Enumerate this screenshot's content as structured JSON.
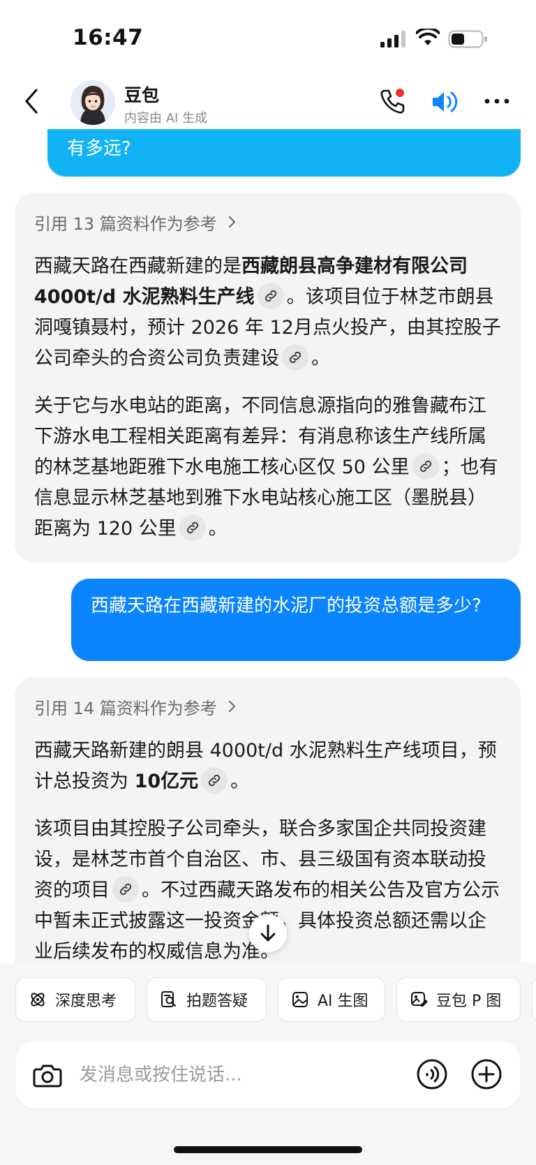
{
  "status": {
    "time": "16:47"
  },
  "header": {
    "bot_name": "豆包",
    "bot_subtitle": "内容由 AI 生成",
    "icons": [
      "back-icon",
      "avatar",
      "phone-icon",
      "speaker-icon",
      "more-icon"
    ],
    "accent_color": "#0a84ff"
  },
  "conversation": {
    "user_message_1_tail": "有多远?",
    "ai_reply_1": {
      "references": "引用 13 篇资料作为参考",
      "p1_a": "西藏天路在西藏新建的是",
      "p1_bold": "西藏朗县高争建材有限公司 4000t/d 水泥熟料生产线",
      "p1_b": "。该项目位于林芝市朗县洞嘎镇聂村，预计 2026 年 12月点火投产，由其控股子公司牵头的合资公司负责建设",
      "p1_c": "。",
      "p2_a": "关于它与水电站的距离，不同信息源指向的雅鲁藏布江下游水电工程相关距离有差异：有消息称该生产线所属的林芝基地距雅下水电施工核心区仅 50 公里",
      "p2_b": "；也有信息显示林芝基地到雅下水电站核心施工区（墨脱县）距离为 120 公里",
      "p2_c": "。"
    },
    "user_message_2": "西藏天路在西藏新建的水泥厂的投资总额是多少?",
    "ai_reply_2": {
      "references": "引用 14 篇资料作为参考",
      "p1_a": "西藏天路新建的朗县 4000t/d 水泥熟料生产线项目，预计总投资为 ",
      "p1_bold": "10亿元",
      "p1_b": "。",
      "p2_a": "该项目由其控股子公司牵头，联合多家国企共同投资建设，是林芝市首个自治区、市、县三级国有资本联动投资的项目",
      "p2_b": "。不过西藏天路发布的相关公告及官方公示中暂未正式披露这一投资金额，具体投资总额还需以企业后续发布的权威信息为准。"
    }
  },
  "quick_actions": [
    {
      "label": "深度思考",
      "icon": "atom-icon"
    },
    {
      "label": "拍题答疑",
      "icon": "photo-question-icon"
    },
    {
      "label": "AI 生图",
      "icon": "image-icon"
    },
    {
      "label": "豆包 P 图",
      "icon": "image-edit-icon"
    }
  ],
  "composer": {
    "placeholder": "发消息或按住说话..."
  }
}
